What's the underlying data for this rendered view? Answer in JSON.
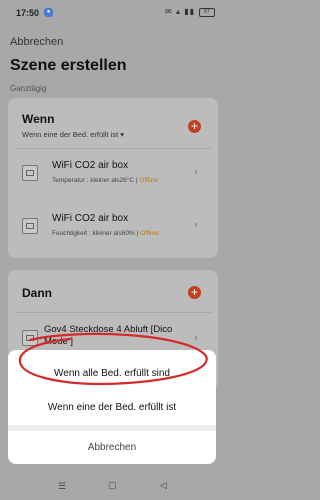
{
  "status_bar": {
    "time": "17:50",
    "battery": "67"
  },
  "header": {
    "back_label": "Abbrechen",
    "title": "Szene erstellen",
    "subtitle": "Ganztägig"
  },
  "wenn": {
    "title": "Wenn",
    "condition_mode": "Wenn eine der Bed. erfüllt ist",
    "conditions": [
      {
        "name": "WiFi CO2 air box",
        "desc": "Temperatur : kleiner als26°C | ",
        "status": "Offline"
      },
      {
        "name": "WiFi CO2 air box",
        "desc": "Feuchtigkeit : kleiner als60% | ",
        "status": "Offline"
      }
    ]
  },
  "dann": {
    "title": "Dann",
    "actions": [
      {
        "name": "Gov4 Steckdose 4 Abluft [Dico Mode ]"
      }
    ]
  },
  "sheet": {
    "options": [
      "Wenn alle Bed. erfüllt sind",
      "Wenn eine der Bed. erfüllt ist"
    ],
    "cancel": "Abbrechen"
  },
  "colors": {
    "accent": "#c0411f",
    "offline": "#c07a10",
    "annotation": "#d42a2a"
  }
}
